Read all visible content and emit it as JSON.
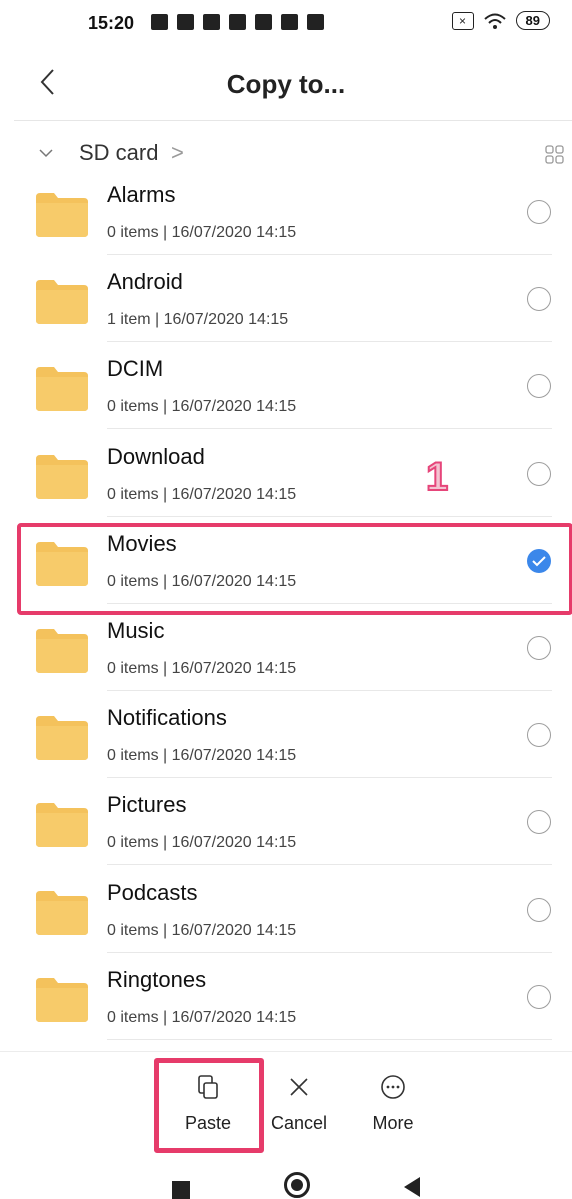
{
  "status_bar": {
    "time": "15:20",
    "battery": "89"
  },
  "header": {
    "title": "Copy to..."
  },
  "breadcrumb": {
    "label": "SD card",
    "separator": ">"
  },
  "folders": [
    {
      "name": "Alarms",
      "meta": "0 items | 16/07/2020 14:15",
      "selected": false
    },
    {
      "name": "Android",
      "meta": "1 item | 16/07/2020 14:15",
      "selected": false
    },
    {
      "name": "DCIM",
      "meta": "0 items | 16/07/2020 14:15",
      "selected": false
    },
    {
      "name": "Download",
      "meta": "0 items | 16/07/2020 14:15",
      "selected": false
    },
    {
      "name": "Movies",
      "meta": "0 items | 16/07/2020 14:15",
      "selected": true
    },
    {
      "name": "Music",
      "meta": "0 items | 16/07/2020 14:15",
      "selected": false
    },
    {
      "name": "Notifications",
      "meta": "0 items | 16/07/2020 14:15",
      "selected": false
    },
    {
      "name": "Pictures",
      "meta": "0 items | 16/07/2020 14:15",
      "selected": false
    },
    {
      "name": "Podcasts",
      "meta": "0 items | 16/07/2020 14:15",
      "selected": false
    },
    {
      "name": "Ringtones",
      "meta": "0 items | 16/07/2020 14:15",
      "selected": false
    }
  ],
  "annotation": {
    "step": "1"
  },
  "toolbar": {
    "paste": "Paste",
    "cancel": "Cancel",
    "more": "More"
  },
  "colors": {
    "accent": "#3b87ea",
    "highlight": "#e63b6a",
    "folder": "#f4c25c"
  }
}
